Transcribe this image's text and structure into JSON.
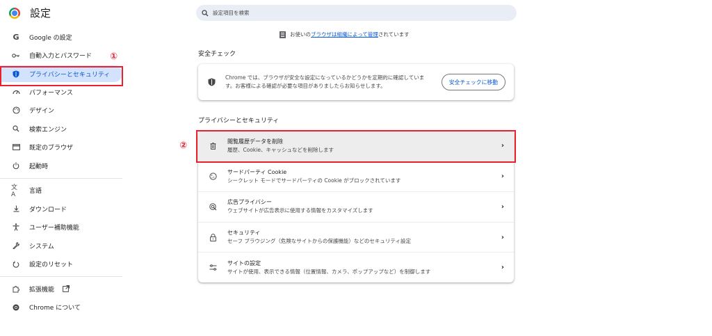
{
  "app": {
    "title": "設定"
  },
  "search": {
    "placeholder": "設定項目を検索"
  },
  "sidebar": {
    "items": [
      {
        "label": "Google の設定",
        "icon": "google-icon"
      },
      {
        "label": "自動入力とパスワード",
        "icon": "key-icon"
      },
      {
        "label": "プライバシーとセキュリティ",
        "icon": "shield-icon",
        "active": true
      },
      {
        "label": "パフォーマンス",
        "icon": "speedometer-icon"
      },
      {
        "label": "デザイン",
        "icon": "palette-icon"
      },
      {
        "label": "検索エンジン",
        "icon": "search-icon"
      },
      {
        "label": "既定のブラウザ",
        "icon": "browser-icon"
      },
      {
        "label": "起動時",
        "icon": "power-icon"
      },
      {
        "label": "言語",
        "icon": "translate-icon"
      },
      {
        "label": "ダウンロード",
        "icon": "download-icon"
      },
      {
        "label": "ユーザー補助機能",
        "icon": "accessibility-icon"
      },
      {
        "label": "システム",
        "icon": "wrench-icon"
      },
      {
        "label": "設定のリセット",
        "icon": "reset-icon"
      },
      {
        "label": "拡張機能",
        "icon": "puzzle-icon"
      },
      {
        "label": "Chrome について",
        "icon": "chrome-icon"
      }
    ]
  },
  "markers": {
    "one": "①",
    "two": "②"
  },
  "managed": {
    "prefix": "お使いの",
    "link1": "ブラウザは組織によって管理",
    "suffix": "されています"
  },
  "safety_check": {
    "title": "安全チェック",
    "text": "Chrome では、ブラウザが安全な設定になっているかどうかを定期的に確認しています。お客様による確認が必要な項目がありましたらお知らせします。",
    "button": "安全チェックに移動"
  },
  "privacy": {
    "title": "プライバシーとセキュリティ",
    "rows": [
      {
        "label": "閲覧履歴データを削除",
        "sub": "履歴、Cookie、キャッシュなどを削除します",
        "icon": "trash-icon"
      },
      {
        "label": "サードパーティ Cookie",
        "sub": "シークレット モードでサードパーティの Cookie がブロックされています",
        "icon": "cookie-icon"
      },
      {
        "label": "広告プライバシー",
        "sub": "ウェブサイトが広告表示に使用する情報をカスタマイズします",
        "icon": "ad-privacy-icon"
      },
      {
        "label": "セキュリティ",
        "sub": "セーフ ブラウジング（危険なサイトからの保護機能）などのセキュリティ設定",
        "icon": "lock-icon"
      },
      {
        "label": "サイトの設定",
        "sub": "サイトが使用、表示できる情報（位置情報、カメラ、ポップアップなど）を制御します",
        "icon": "sliders-icon"
      }
    ]
  },
  "colors": {
    "accent": "#0b57d0",
    "active_bg": "#d3e3fd",
    "highlight": "#e8212c"
  }
}
